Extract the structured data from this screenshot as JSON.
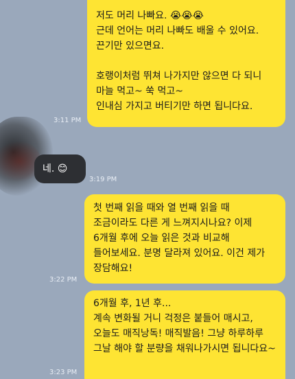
{
  "messages": [
    {
      "side": "sent",
      "text": "저도 머리 나빠요. 😭😭😭\n근데 언어는 머리 나빠도 배울 수 있어요. 끈기만 있으면요.\n\n호랭이처럼 뛰쳐 나가지만 않으면 다 되니 마늘 먹고~ 쑥 먹고~\n인내심 가지고 버티기만 하면 됩니다요.",
      "time": "3:11 PM"
    },
    {
      "side": "received",
      "text": "네. 😊",
      "time": "3:19 PM"
    },
    {
      "side": "sent",
      "text": "첫 번째 읽을 때와 열 번째 읽을 때 조금이라도 다른 게 느껴지시나요? 이제 6개월 후에 오늘 읽은 것과 비교해 들어보세요. 분명 달라져 있어요. 이건 제가 장담해요!",
      "time": "3:22 PM"
    },
    {
      "side": "sent",
      "text": "6개월 후, 1년 후...\n계속 변화될 거니 걱정은 붙들어 매시고, 오늘도 매직낭독! 매직발음! 그냥 하루하루 그날 해야 할 분량을 채워나가시면 됩니다요~",
      "time": "3:23 PM"
    }
  ],
  "colors": {
    "background": "#9aa8bb",
    "sent_bubble": "#fee433",
    "received_bubble": "#2d2f33"
  }
}
